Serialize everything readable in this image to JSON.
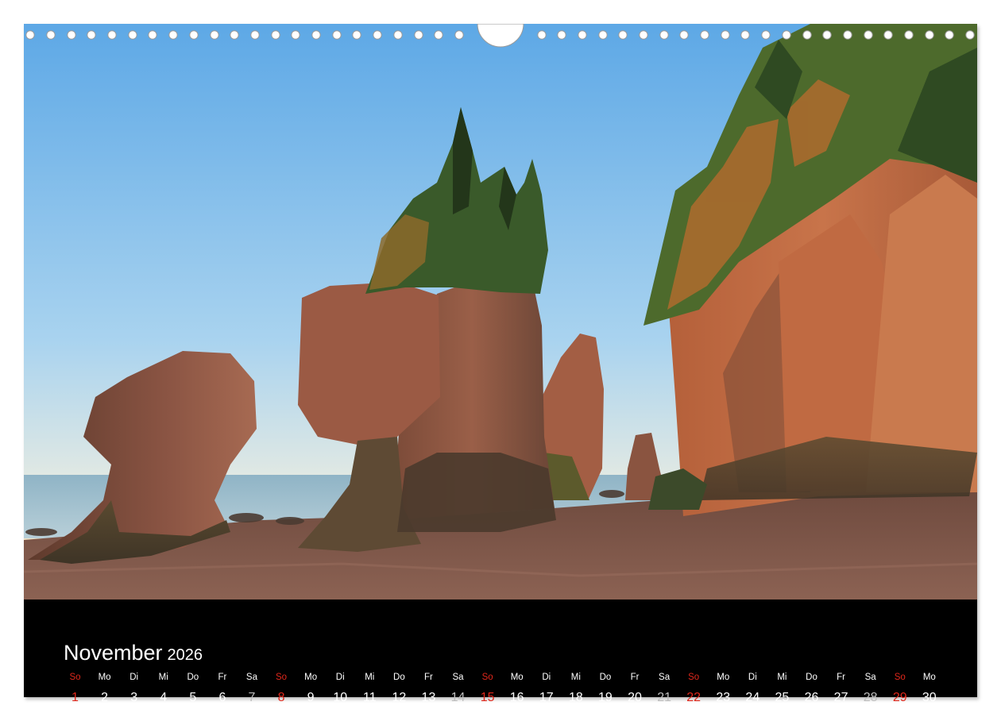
{
  "calendar": {
    "month": "November",
    "year": "2026",
    "days": [
      {
        "dn": "So",
        "n": "1",
        "type": "sun"
      },
      {
        "dn": "Mo",
        "n": "2",
        "type": "wd"
      },
      {
        "dn": "Di",
        "n": "3",
        "type": "wd"
      },
      {
        "dn": "Mi",
        "n": "4",
        "type": "wd"
      },
      {
        "dn": "Do",
        "n": "5",
        "type": "wd"
      },
      {
        "dn": "Fr",
        "n": "6",
        "type": "wd"
      },
      {
        "dn": "Sa",
        "n": "7",
        "type": "sat"
      },
      {
        "dn": "So",
        "n": "8",
        "type": "sun"
      },
      {
        "dn": "Mo",
        "n": "9",
        "type": "wd"
      },
      {
        "dn": "Di",
        "n": "10",
        "type": "wd"
      },
      {
        "dn": "Mi",
        "n": "11",
        "type": "wd"
      },
      {
        "dn": "Do",
        "n": "12",
        "type": "wd"
      },
      {
        "dn": "Fr",
        "n": "13",
        "type": "wd"
      },
      {
        "dn": "Sa",
        "n": "14",
        "type": "sat"
      },
      {
        "dn": "So",
        "n": "15",
        "type": "sun"
      },
      {
        "dn": "Mo",
        "n": "16",
        "type": "wd"
      },
      {
        "dn": "Di",
        "n": "17",
        "type": "wd"
      },
      {
        "dn": "Mi",
        "n": "18",
        "type": "wd"
      },
      {
        "dn": "Do",
        "n": "19",
        "type": "wd"
      },
      {
        "dn": "Fr",
        "n": "20",
        "type": "wd"
      },
      {
        "dn": "Sa",
        "n": "21",
        "type": "sat"
      },
      {
        "dn": "So",
        "n": "22",
        "type": "sun"
      },
      {
        "dn": "Mo",
        "n": "23",
        "type": "wd"
      },
      {
        "dn": "Di",
        "n": "24",
        "type": "wd"
      },
      {
        "dn": "Mi",
        "n": "25",
        "type": "wd"
      },
      {
        "dn": "Do",
        "n": "26",
        "type": "wd"
      },
      {
        "dn": "Fr",
        "n": "27",
        "type": "wd"
      },
      {
        "dn": "Sa",
        "n": "28",
        "type": "sat"
      },
      {
        "dn": "So",
        "n": "29",
        "type": "sun"
      },
      {
        "dn": "Mo",
        "n": "30",
        "type": "wd"
      }
    ]
  },
  "colors": {
    "sunday": "#e0271b",
    "saturday": "#bdbdbd",
    "weekday": "#ffffff",
    "footer_background": "#000000"
  }
}
